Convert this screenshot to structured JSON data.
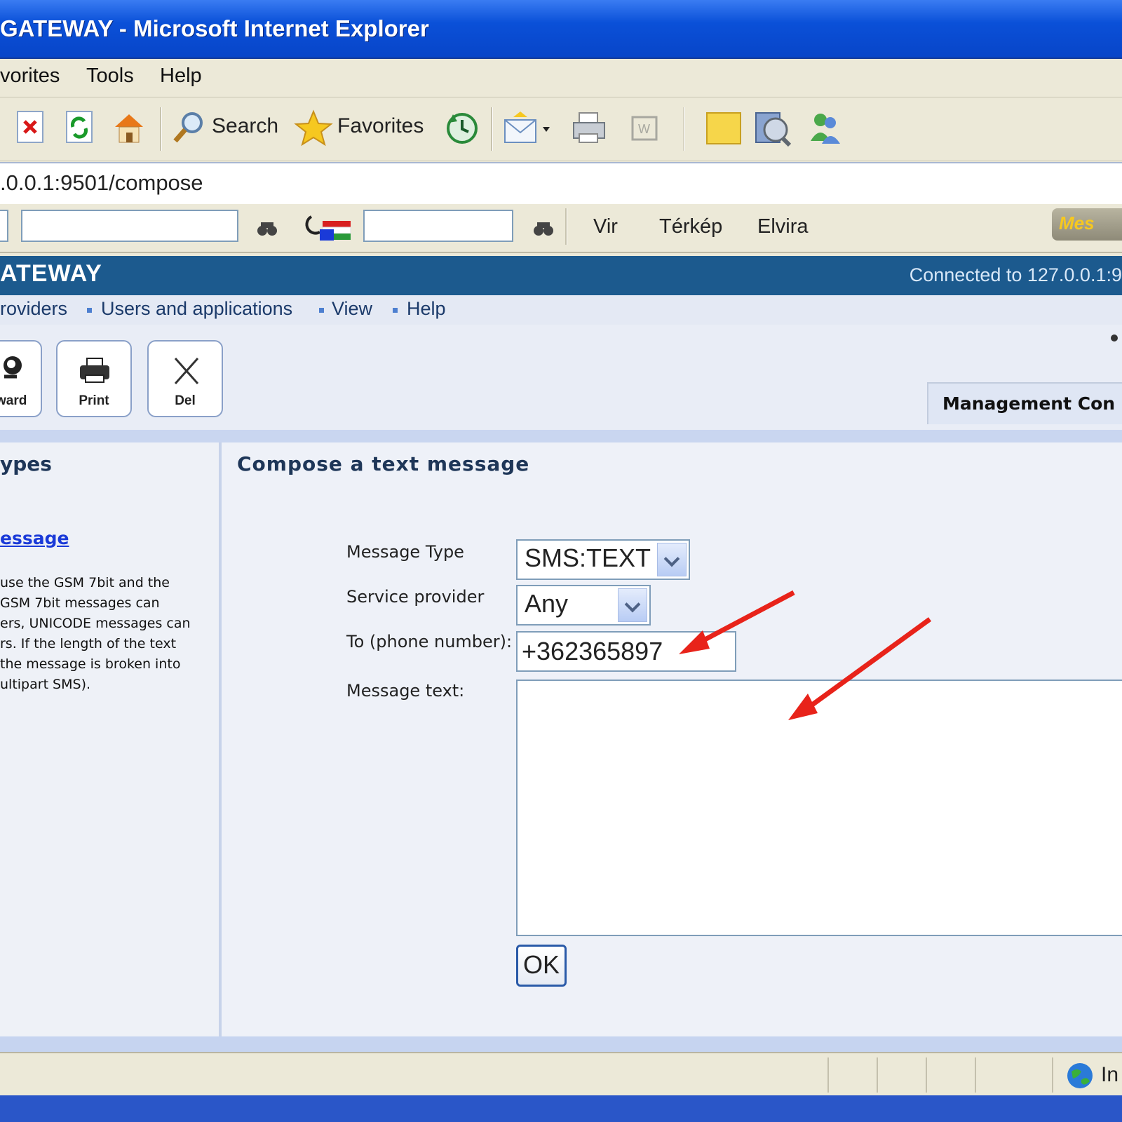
{
  "window": {
    "title": "GATEWAY - Microsoft Internet Explorer"
  },
  "menu": {
    "items": [
      "vorites",
      "Tools",
      "Help"
    ]
  },
  "toolbar": {
    "search_label": "Search",
    "favorites_label": "Favorites",
    "icons": [
      "stop-icon",
      "refresh-icon",
      "home-icon",
      "search-icon",
      "favorites-star-icon",
      "history-icon",
      "mail-icon",
      "print-icon",
      "edit-icon",
      "folder-icon",
      "media-icon",
      "messenger-icon"
    ]
  },
  "address": {
    "url": ".0.0.1:9501/compose"
  },
  "links_toolbar": {
    "links": [
      "Vir",
      "Térkép",
      "Elvira"
    ],
    "right_badge": "Mes"
  },
  "app": {
    "brand": "ATEWAY",
    "connection": "Connected to 127.0.0.1:9",
    "nav": [
      "roviders",
      "Users and applications",
      "View",
      "Help"
    ],
    "actions": [
      {
        "label": "ward",
        "icon": "forward-icon"
      },
      {
        "label": "Print",
        "icon": "printer-icon"
      },
      {
        "label": "Del",
        "icon": "delete-x-icon"
      }
    ],
    "management_tab": "Management Con"
  },
  "left_panel": {
    "heading": "ypes",
    "link": "essage",
    "description": [
      "use the GSM 7bit and the",
      " GSM 7bit messages can",
      "ers, UNICODE messages can",
      "rs. If the length of the text",
      " the message is broken into",
      "ultipart SMS)."
    ]
  },
  "form": {
    "heading": "Compose a text message",
    "message_type_label": "Message Type",
    "message_type_value": "SMS:TEXT",
    "service_provider_label": "Service provider",
    "service_provider_value": "Any",
    "phone_label": "To (phone number):",
    "phone_value": "+362365897",
    "message_text_label": "Message text:",
    "message_text_value": "",
    "ok_label": "OK"
  },
  "annotation": {
    "arrow_color": "#e8231a"
  },
  "statusbar": {
    "zone_text": "In"
  },
  "colors": {
    "titlebar": "#0a50d8",
    "app_header": "#1c5a8e",
    "link": "#1a3ad8"
  }
}
